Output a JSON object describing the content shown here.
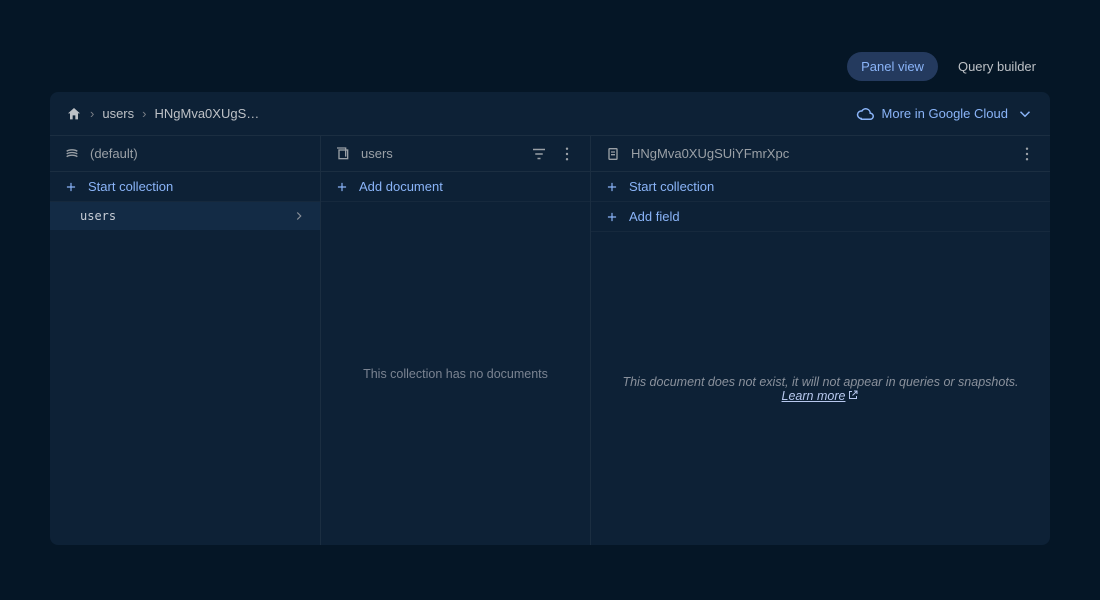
{
  "view_toggle": {
    "panel_view": "Panel view",
    "query_builder": "Query builder"
  },
  "breadcrumb": {
    "seg1": "users",
    "seg2": "HNgMva0XUgS…"
  },
  "more_cloud": "More in Google Cloud",
  "panel_db": {
    "title": "(default)",
    "start_collection": "Start collection",
    "items": [
      "users"
    ]
  },
  "panel_collection": {
    "title": "users",
    "add_document": "Add document",
    "empty": "This collection has no documents"
  },
  "panel_document": {
    "title": "HNgMva0XUgSUiYFmrXpc",
    "start_collection": "Start collection",
    "add_field": "Add field",
    "empty_prefix": "This document does not exist, it will not appear in queries or snapshots. ",
    "learn_more": "Learn more"
  }
}
